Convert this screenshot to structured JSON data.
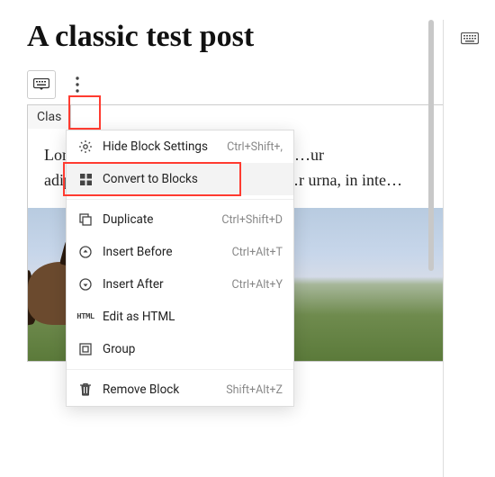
{
  "post": {
    "title": "A classic test post",
    "block_label": "Clas",
    "content": "Lor………………………………………ur adip……………………………………r urna, in inte…"
  },
  "menu": {
    "items": [
      {
        "icon": "gear-icon",
        "label": "Hide Block Settings",
        "shortcut": "Ctrl+Shift+,"
      },
      {
        "icon": "grid-icon",
        "label": "Convert to Blocks",
        "shortcut": ""
      },
      {
        "icon": "duplicate-icon",
        "label": "Duplicate",
        "shortcut": "Ctrl+Shift+D"
      },
      {
        "icon": "insert-before-icon",
        "label": "Insert Before",
        "shortcut": "Ctrl+Alt+T"
      },
      {
        "icon": "insert-after-icon",
        "label": "Insert After",
        "shortcut": "Ctrl+Alt+Y"
      },
      {
        "icon": "html-icon",
        "label": "Edit as HTML",
        "shortcut": ""
      },
      {
        "icon": "group-icon",
        "label": "Group",
        "shortcut": ""
      },
      {
        "icon": "trash-icon",
        "label": "Remove Block",
        "shortcut": "Shift+Alt+Z"
      }
    ],
    "hovered_index": 1,
    "separators_after": [
      1,
      6
    ]
  }
}
